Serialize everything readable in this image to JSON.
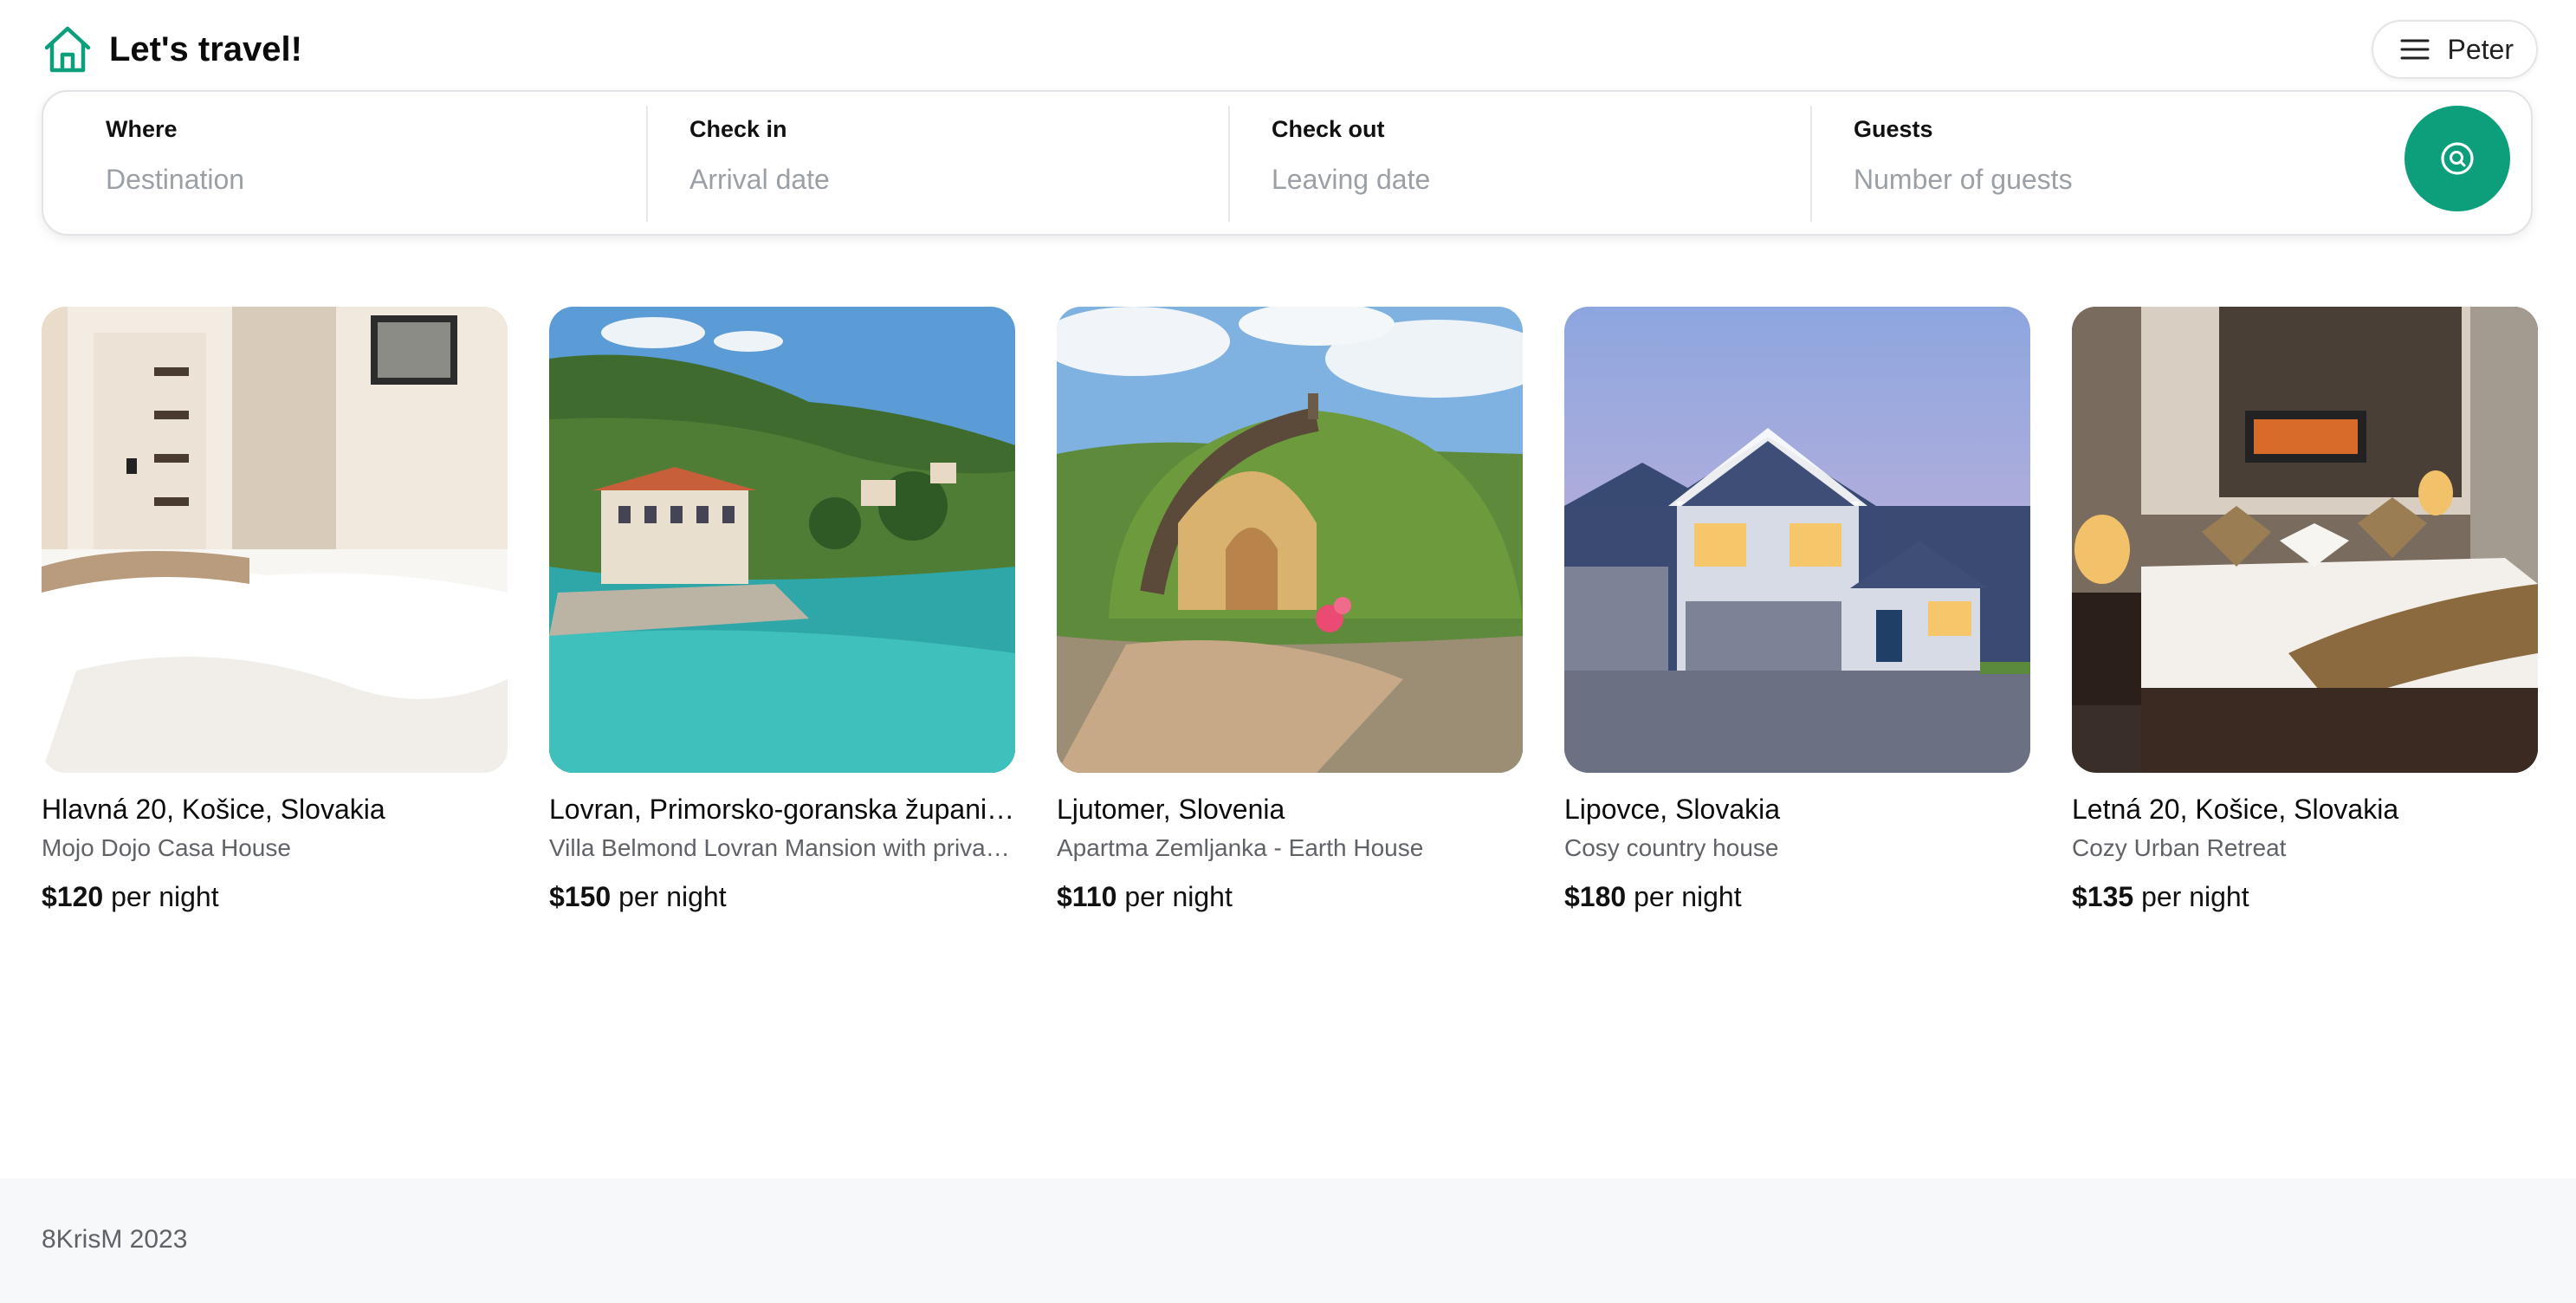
{
  "header": {
    "title": "Let's travel!",
    "user_name": "Peter",
    "icons": {
      "brand": "home-icon",
      "menu": "hamburger-menu-icon"
    }
  },
  "search": {
    "where_label": "Where",
    "where_placeholder": "Destination",
    "checkin_label": "Check in",
    "checkin_placeholder": "Arrival date",
    "checkout_label": "Check out",
    "checkout_placeholder": "Leaving date",
    "guests_label": "Guests",
    "guests_placeholder": "Number of guests",
    "button_icon": "search-icon"
  },
  "listings": [
    {
      "title": "Hlavná 20, Košice, Slovakia",
      "subtitle": "Mojo Dojo Casa House",
      "price": "$120",
      "unit": "per night",
      "image": "bedroom-photo"
    },
    {
      "title": "Lovran, Primorsko-goranska županija, Croatia",
      "subtitle": "Villa Belmond Lovran Mansion with private beach",
      "price": "$150",
      "unit": "per night",
      "image": "coastal-villa-photo"
    },
    {
      "title": "Ljutomer, Slovenia",
      "subtitle": "Apartma Zemljanka - Earth House",
      "price": "$110",
      "unit": "per night",
      "image": "earth-house-photo"
    },
    {
      "title": "Lipovce, Slovakia",
      "subtitle": "Cosy country house",
      "price": "$180",
      "unit": "per night",
      "image": "country-house-photo"
    },
    {
      "title": "Letná 20, Košice, Slovakia",
      "subtitle": "Cozy Urban Retreat",
      "price": "$135",
      "unit": "per night",
      "image": "hotel-room-photo"
    }
  ],
  "footer": {
    "text": "8KrisM 2023"
  },
  "colors": {
    "accent": "#0d9f7c",
    "footer_bg": "#f7f8fa",
    "muted_text": "#5f6368"
  }
}
